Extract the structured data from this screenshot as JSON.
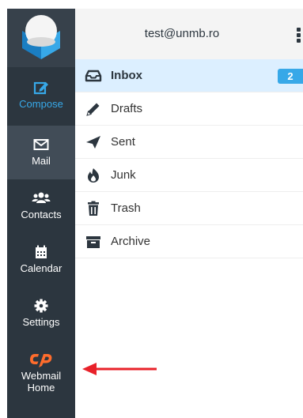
{
  "sidebar": {
    "items": [
      {
        "label": "Compose",
        "icon": "compose-icon"
      },
      {
        "label": "Mail",
        "icon": "envelope-icon"
      },
      {
        "label": "Contacts",
        "icon": "users-icon"
      },
      {
        "label": "Calendar",
        "icon": "calendar-icon"
      },
      {
        "label": "Settings",
        "icon": "gear-icon"
      },
      {
        "label_line1": "Webmail",
        "label_line2": "Home",
        "icon": "cpanel-logo-icon"
      }
    ]
  },
  "header": {
    "account": "test@unmb.ro"
  },
  "folders": [
    {
      "name": "Inbox",
      "icon": "inbox-icon",
      "count": "2",
      "selected": true
    },
    {
      "name": "Drafts",
      "icon": "pencil-icon"
    },
    {
      "name": "Sent",
      "icon": "paper-plane-icon"
    },
    {
      "name": "Junk",
      "icon": "fire-icon"
    },
    {
      "name": "Trash",
      "icon": "trash-icon"
    },
    {
      "name": "Archive",
      "icon": "archive-icon"
    }
  ],
  "colors": {
    "sidebar_bg": "#2c363f",
    "accent": "#37a8e8",
    "selected_bg": "#dcefff",
    "cpanel_orange": "#ff6c2c",
    "annotation_arrow": "#e8212a"
  }
}
